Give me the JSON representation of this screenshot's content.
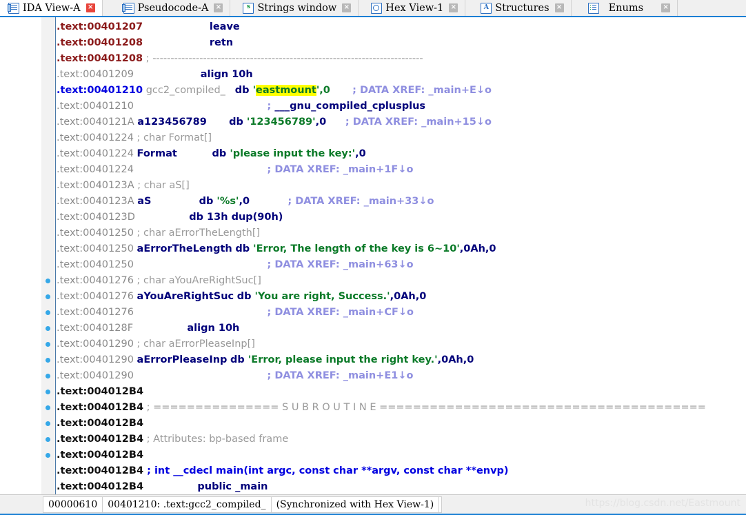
{
  "window": {
    "title": "IDA View-A"
  },
  "tabs": [
    {
      "label": "IDA View-A",
      "icon": "document-icon",
      "active": true,
      "close_label": "×"
    },
    {
      "label": "Pseudocode-A",
      "icon": "document-icon",
      "active": false,
      "close_label": "×"
    },
    {
      "label": "Strings window",
      "icon": "strings-icon",
      "active": false,
      "close_label": "×"
    },
    {
      "label": "Hex View-1",
      "icon": "hex-view-icon",
      "active": false,
      "close_label": "×"
    },
    {
      "label": "Structures",
      "icon": "structures-icon",
      "active": false,
      "close_label": "×"
    },
    {
      "label": "Enums",
      "icon": "enums-icon",
      "active": false,
      "close_label": "×"
    }
  ],
  "colors": {
    "accent": "#1a7fd4",
    "address_code": "#8b1a1a",
    "address_data": "#8a8a8a",
    "address_selected": "#0000e0",
    "identifier": "#00007a",
    "string_literal": "#0b7a28",
    "comment": "#9a9a9a",
    "comment_blue": "#0000e0",
    "xref": "#8f8fe0",
    "highlight_bg": "#ffff00",
    "breakpoint_dot": "#35a8e8"
  },
  "disassembly": {
    "lines": [
      {
        "n": 0,
        "addr": ".text:00401207",
        "addr_style": "code",
        "body": [
          {
            "t": "                     ",
            "c": "plain"
          },
          {
            "t": "leave",
            "c": "kw"
          }
        ]
      },
      {
        "n": 1,
        "addr": ".text:00401208",
        "addr_style": "code",
        "body": [
          {
            "t": "                     ",
            "c": "plain"
          },
          {
            "t": "retn",
            "c": "kw"
          }
        ]
      },
      {
        "n": 2,
        "addr": ".text:00401208",
        "addr_style": "code",
        "body": [
          {
            "t": " ; ",
            "c": "cmt"
          },
          {
            "t": "---------------------------------------------------------------------------",
            "c": "sep"
          }
        ]
      },
      {
        "n": 3,
        "addr": ".text:00401209",
        "addr_style": "data",
        "body": [
          {
            "t": "                     ",
            "c": "plain"
          },
          {
            "t": "align 10h",
            "c": "kw"
          }
        ]
      },
      {
        "n": 4,
        "addr": ".text:00401210",
        "addr_style": "sel",
        "body": [
          {
            "t": " ",
            "c": "plain"
          },
          {
            "t": "gcc2_compiled_",
            "c": "namedim"
          },
          {
            "t": "   ",
            "c": "plain"
          },
          {
            "t": "db ",
            "c": "kw"
          },
          {
            "t": "'",
            "c": "str"
          },
          {
            "t": "eastmount",
            "c": "hl"
          },
          {
            "t": "',0",
            "c": "str"
          },
          {
            "t": "       ",
            "c": "plain"
          },
          {
            "t": "; DATA XREF: ",
            "c": "xref"
          },
          {
            "t": "_main+E",
            "c": "xref"
          },
          {
            "t": "↓o",
            "c": "xref"
          }
        ]
      },
      {
        "n": 5,
        "addr": ".text:00401210",
        "addr_style": "data",
        "body": [
          {
            "t": "                                          ",
            "c": "plain"
          },
          {
            "t": "; ",
            "c": "xref"
          },
          {
            "t": "___gnu_compiled_cplusplus",
            "c": "xref-b"
          }
        ]
      },
      {
        "n": 6,
        "addr": ".text:0040121A",
        "addr_style": "data",
        "body": [
          {
            "t": " ",
            "c": "plain"
          },
          {
            "t": "a123456789",
            "c": "name"
          },
          {
            "t": "       ",
            "c": "plain"
          },
          {
            "t": "db ",
            "c": "kw"
          },
          {
            "t": "'123456789'",
            "c": "str"
          },
          {
            "t": ",0",
            "c": "num"
          },
          {
            "t": "      ",
            "c": "plain"
          },
          {
            "t": "; DATA XREF: ",
            "c": "xref"
          },
          {
            "t": "_main+15",
            "c": "xref"
          },
          {
            "t": "↓o",
            "c": "xref"
          }
        ]
      },
      {
        "n": 7,
        "addr": ".text:00401224",
        "addr_style": "data",
        "body": [
          {
            "t": " ; char Format[]",
            "c": "cmt"
          }
        ]
      },
      {
        "n": 8,
        "addr": ".text:00401224",
        "addr_style": "data",
        "body": [
          {
            "t": " ",
            "c": "plain"
          },
          {
            "t": "Format",
            "c": "name"
          },
          {
            "t": "           ",
            "c": "plain"
          },
          {
            "t": "db ",
            "c": "kw"
          },
          {
            "t": "'please input the key:'",
            "c": "str"
          },
          {
            "t": ",0",
            "c": "num"
          }
        ]
      },
      {
        "n": 9,
        "addr": ".text:00401224",
        "addr_style": "data",
        "body": [
          {
            "t": "                                          ",
            "c": "plain"
          },
          {
            "t": "; DATA XREF: ",
            "c": "xref"
          },
          {
            "t": "_main+1F",
            "c": "xref"
          },
          {
            "t": "↓o",
            "c": "xref"
          }
        ]
      },
      {
        "n": 10,
        "addr": ".text:0040123A",
        "addr_style": "data",
        "body": [
          {
            "t": " ; char aS[]",
            "c": "cmt"
          }
        ]
      },
      {
        "n": 11,
        "addr": ".text:0040123A",
        "addr_style": "data",
        "body": [
          {
            "t": " ",
            "c": "plain"
          },
          {
            "t": "aS",
            "c": "name"
          },
          {
            "t": "               ",
            "c": "plain"
          },
          {
            "t": "db ",
            "c": "kw"
          },
          {
            "t": "'%s'",
            "c": "str"
          },
          {
            "t": ",0",
            "c": "num"
          },
          {
            "t": "            ",
            "c": "plain"
          },
          {
            "t": "; DATA XREF: ",
            "c": "xref"
          },
          {
            "t": "_main+33",
            "c": "xref"
          },
          {
            "t": "↓o",
            "c": "xref"
          }
        ]
      },
      {
        "n": 12,
        "addr": ".text:0040123D",
        "addr_style": "data",
        "body": [
          {
            "t": "                 ",
            "c": "plain"
          },
          {
            "t": "db ",
            "c": "kw"
          },
          {
            "t": "13h dup(90h)",
            "c": "num"
          }
        ]
      },
      {
        "n": 13,
        "addr": ".text:00401250",
        "addr_style": "data",
        "body": [
          {
            "t": " ; char aErrorTheLength[]",
            "c": "cmt"
          }
        ]
      },
      {
        "n": 14,
        "addr": ".text:00401250",
        "addr_style": "data",
        "body": [
          {
            "t": " ",
            "c": "plain"
          },
          {
            "t": "aErrorTheLength",
            "c": "name"
          },
          {
            "t": " ",
            "c": "plain"
          },
          {
            "t": "db ",
            "c": "kw"
          },
          {
            "t": "'Error, The length of the key is 6~10'",
            "c": "str"
          },
          {
            "t": ",0Ah,0",
            "c": "num"
          }
        ]
      },
      {
        "n": 15,
        "addr": ".text:00401250",
        "addr_style": "data",
        "body": [
          {
            "t": "                                          ",
            "c": "plain"
          },
          {
            "t": "; DATA XREF: ",
            "c": "xref"
          },
          {
            "t": "_main+63",
            "c": "xref"
          },
          {
            "t": "↓o",
            "c": "xref"
          }
        ]
      },
      {
        "n": 16,
        "addr": ".text:00401276",
        "addr_style": "data",
        "body": [
          {
            "t": " ; char aYouAreRightSuc[]",
            "c": "cmt"
          }
        ],
        "bp": true
      },
      {
        "n": 17,
        "addr": ".text:00401276",
        "addr_style": "data",
        "body": [
          {
            "t": " ",
            "c": "plain"
          },
          {
            "t": "aYouAreRightSuc",
            "c": "name"
          },
          {
            "t": " ",
            "c": "plain"
          },
          {
            "t": "db ",
            "c": "kw"
          },
          {
            "t": "'You are right, Success.'",
            "c": "str"
          },
          {
            "t": ",0Ah,0",
            "c": "num"
          }
        ],
        "bp": true
      },
      {
        "n": 18,
        "addr": ".text:00401276",
        "addr_style": "data",
        "body": [
          {
            "t": "                                          ",
            "c": "plain"
          },
          {
            "t": "; DATA XREF: ",
            "c": "xref"
          },
          {
            "t": "_main+CF",
            "c": "xref"
          },
          {
            "t": "↓o",
            "c": "xref"
          }
        ],
        "bp": true
      },
      {
        "n": 19,
        "addr": ".text:0040128F",
        "addr_style": "data",
        "body": [
          {
            "t": "                 ",
            "c": "plain"
          },
          {
            "t": "align 10h",
            "c": "kw"
          }
        ],
        "bp": true
      },
      {
        "n": 20,
        "addr": ".text:00401290",
        "addr_style": "data",
        "body": [
          {
            "t": " ; char aErrorPleaseInp[]",
            "c": "cmt"
          }
        ],
        "bp": true
      },
      {
        "n": 21,
        "addr": ".text:00401290",
        "addr_style": "data",
        "body": [
          {
            "t": " ",
            "c": "plain"
          },
          {
            "t": "aErrorPleaseInp",
            "c": "name"
          },
          {
            "t": " ",
            "c": "plain"
          },
          {
            "t": "db ",
            "c": "kw"
          },
          {
            "t": "'Error, please input the right key.'",
            "c": "str"
          },
          {
            "t": ",0Ah,0",
            "c": "num"
          }
        ],
        "bp": true
      },
      {
        "n": 22,
        "addr": ".text:00401290",
        "addr_style": "data",
        "body": [
          {
            "t": "                                          ",
            "c": "plain"
          },
          {
            "t": "; DATA XREF: ",
            "c": "xref"
          },
          {
            "t": "_main+E1",
            "c": "xref"
          },
          {
            "t": "↓o",
            "c": "xref"
          }
        ],
        "bp": true
      },
      {
        "n": 23,
        "addr": ".text:004012B4",
        "addr_style": "blk",
        "body": [],
        "bp": true
      },
      {
        "n": 24,
        "addr": ".text:004012B4",
        "addr_style": "blk",
        "body": [
          {
            "t": " ; ",
            "c": "cmt"
          },
          {
            "t": "=============== S U B R O U T I N E =======================================",
            "c": "sep"
          }
        ],
        "bp": true
      },
      {
        "n": 25,
        "addr": ".text:004012B4",
        "addr_style": "blk",
        "body": [],
        "bp": true
      },
      {
        "n": 26,
        "addr": ".text:004012B4",
        "addr_style": "blk",
        "body": [
          {
            "t": " ; Attributes: bp-based frame",
            "c": "cmt"
          }
        ],
        "bp": true
      },
      {
        "n": 27,
        "addr": ".text:004012B4",
        "addr_style": "blk",
        "body": [],
        "bp": true
      },
      {
        "n": 28,
        "addr": ".text:004012B4",
        "addr_style": "blk",
        "body": [
          {
            "t": " ; int __cdecl main(int argc, const char **argv, const char **envp)",
            "c": "cmt-blue"
          }
        ]
      },
      {
        "n": 29,
        "addr": ".text:004012B4",
        "addr_style": "blk",
        "body": [
          {
            "t": "                 ",
            "c": "plain"
          },
          {
            "t": "public _main",
            "c": "kw"
          }
        ]
      }
    ]
  },
  "statusbar": {
    "offset": "00000610",
    "address": "00401210: .text:gcc2_compiled_",
    "sync": "(Synchronized with Hex View-1)"
  },
  "watermark": {
    "text": "https://blog.csdn.net/Eastmount"
  }
}
